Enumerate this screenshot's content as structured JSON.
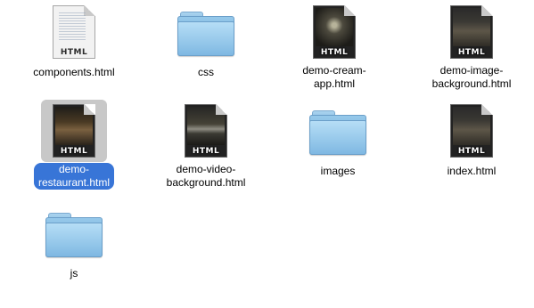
{
  "window": {
    "view": "Icon view"
  },
  "items": [
    {
      "name": "components.html",
      "kind": "document",
      "badge": "HTML",
      "thumbnail": "text-page",
      "selected": false
    },
    {
      "name": "css",
      "kind": "folder",
      "selected": false
    },
    {
      "name": "demo-cream-\napp.html",
      "kind": "document",
      "badge": "HTML",
      "thumbnail": "dark-cream",
      "selected": false
    },
    {
      "name": "demo-image-\nbackground.html",
      "kind": "document",
      "badge": "HTML",
      "thumbnail": "dark",
      "selected": false
    },
    {
      "name": "demo-\nrestaurant.html",
      "kind": "document",
      "badge": "HTML",
      "thumbnail": "dark-restaurant",
      "selected": true
    },
    {
      "name": "demo-video-\nbackground.html",
      "kind": "document",
      "badge": "HTML",
      "thumbnail": "dark-lake",
      "selected": false
    },
    {
      "name": "images",
      "kind": "folder",
      "selected": false
    },
    {
      "name": "index.html",
      "kind": "document",
      "badge": "HTML",
      "thumbnail": "dark",
      "selected": false
    },
    {
      "name": "js",
      "kind": "folder",
      "selected": false
    }
  ],
  "colors": {
    "selection": "#3875d7",
    "selection_icon_bg": "#c8c8c8",
    "folder": "#8ec2e6"
  }
}
